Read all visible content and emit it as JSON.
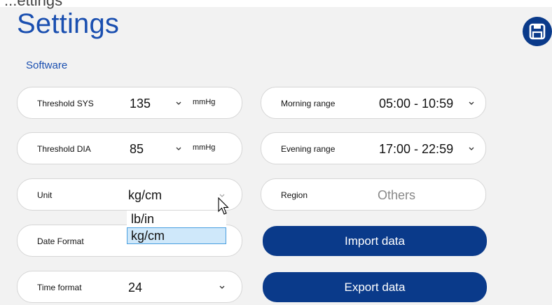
{
  "header": {
    "cut_text": "...ettings",
    "title": "Settings",
    "save_icon": "floppy-disk-icon"
  },
  "section": {
    "label": "Software"
  },
  "left": {
    "threshold_sys": {
      "label": "Threshold SYS",
      "value": "135",
      "unit": "mmHg"
    },
    "threshold_dia": {
      "label": "Threshold DIA",
      "value": "85",
      "unit": "mmHg"
    },
    "unit": {
      "label": "Unit",
      "value": "kg/cm"
    },
    "date_format": {
      "label": "Date Format"
    },
    "time_format": {
      "label": "Time format",
      "value": "24"
    }
  },
  "right": {
    "morning_range": {
      "label": "Morning range",
      "value": "05:00 - 10:59"
    },
    "evening_range": {
      "label": "Evening range",
      "value": "17:00 - 22:59"
    },
    "region": {
      "label": "Region",
      "value": "Others"
    },
    "import_label": "Import data",
    "export_label": "Export data"
  },
  "unit_dropdown": {
    "options": [
      "lb/in",
      "kg/cm"
    ],
    "selected": "kg/cm"
  },
  "colors": {
    "title": "#1a4fb0",
    "button": "#0a3a8a",
    "selected_option": "#cfe8fa"
  }
}
